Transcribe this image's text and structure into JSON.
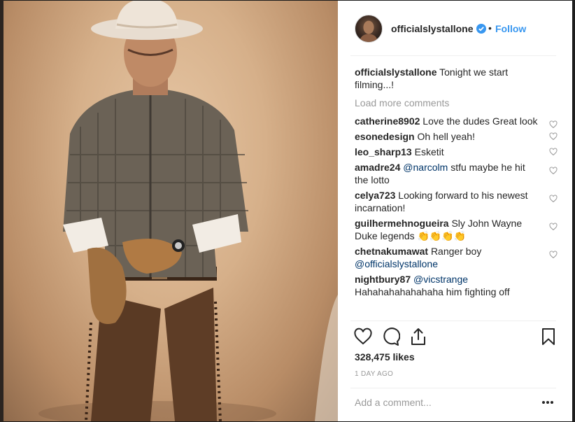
{
  "post": {
    "image_alt": "Man in cowboy hat, plaid shirt, gloves and fringed chaps against warm backdrop"
  },
  "header": {
    "username": "officialslystallone",
    "separator": "•",
    "follow_label": "Follow",
    "verified_icon": "verified-badge-icon",
    "accent_color": "#3897f0"
  },
  "caption": {
    "username": "officialslystallone",
    "text": "Tonight we start filming...!"
  },
  "load_more_label": "Load more comments",
  "comments": [
    {
      "user": "catherine8902",
      "mention": "",
      "text": "Love the dudes Great look"
    },
    {
      "user": "esonedesign",
      "mention": "",
      "text": "Oh hell yeah!"
    },
    {
      "user": "leo_sharp13",
      "mention": "",
      "text": "Esketit"
    },
    {
      "user": "amadre24",
      "mention": "@narcolm",
      "text": "stfu maybe he hit the lotto"
    },
    {
      "user": "celya723",
      "mention": "",
      "text": "Looking forward to his newest incarnation!"
    },
    {
      "user": "guilhermehnogueira",
      "mention": "",
      "text": "Sly John Wayne Duke legends 👏👏👏👏"
    },
    {
      "user": "chetnakumawat",
      "mention": "",
      "text": "Ranger boy",
      "trailing_mention": "@officialslystallone"
    },
    {
      "user": "nightbury87",
      "mention": "@vicstrange",
      "text": "Hahahahahahahaha him fighting off"
    }
  ],
  "actions": {
    "like_icon": "heart-icon",
    "comment_icon": "comment-icon",
    "share_icon": "share-icon",
    "save_icon": "bookmark-icon"
  },
  "likes_text": "328,475 likes",
  "timestamp": "1 DAY AGO",
  "add_comment_placeholder": "Add a comment...",
  "more_options_icon": "more-options-icon"
}
